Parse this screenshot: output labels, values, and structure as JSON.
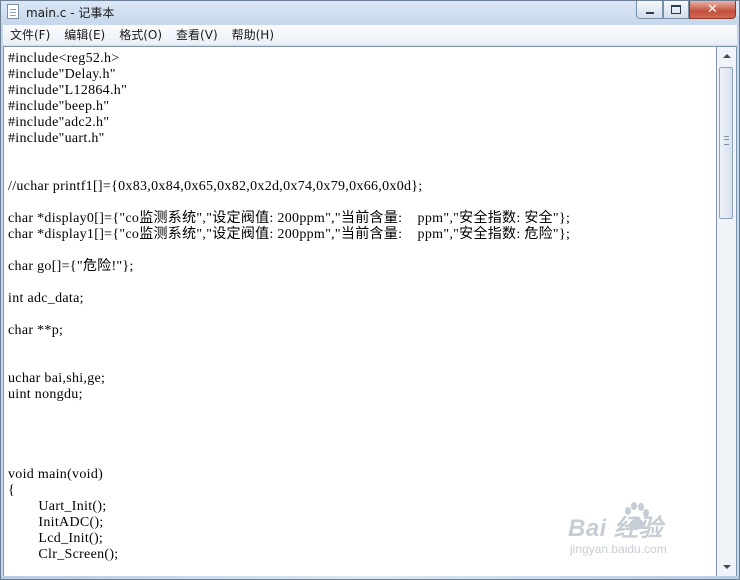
{
  "window": {
    "title": "main.c - 记事本",
    "icon": "notepad-icon",
    "controls": {
      "minimize_icon": "minimize-icon",
      "maximize_icon": "maximize-icon",
      "close_glyph": "✕"
    }
  },
  "menu": {
    "items": [
      {
        "label": "文件(F)"
      },
      {
        "label": "编辑(E)"
      },
      {
        "label": "格式(O)"
      },
      {
        "label": "查看(V)"
      },
      {
        "label": "帮助(H)"
      }
    ]
  },
  "editor": {
    "lines": [
      "#include<reg52.h>",
      "#include\"Delay.h\"",
      "#include\"L12864.h\"",
      "#include\"beep.h\"",
      "#include\"adc2.h\"",
      "#include\"uart.h\"",
      "",
      "",
      "//uchar printf1[]={0x83,0x84,0x65,0x82,0x2d,0x74,0x79,0x66,0x0d};",
      "",
      "char *display0[]={\"co监测系统\",\"设定阀值: 200ppm\",\"当前含量:    ppm\",\"安全指数: 安全\"};",
      "char *display1[]={\"co监测系统\",\"设定阀值: 200ppm\",\"当前含量:    ppm\",\"安全指数: 危险\"};",
      "",
      "char go[]={\"危险!\"};",
      "",
      "int adc_data;",
      "",
      "char **p;",
      "",
      "",
      "uchar bai,shi,ge;",
      "uint nongdu;",
      "",
      "",
      "",
      "",
      "void main(void)",
      "{",
      "        Uart_Init();",
      "        InitADC();",
      "        Lcd_Init();",
      "        Clr_Screen();"
    ]
  },
  "watermark": {
    "logo_text": "Bai  经验",
    "url": "jingyan.baidu.com"
  },
  "colors": {
    "frame": "#c5d7ec",
    "close_button": "#c4503c",
    "editor_bg": "#ffffff"
  }
}
